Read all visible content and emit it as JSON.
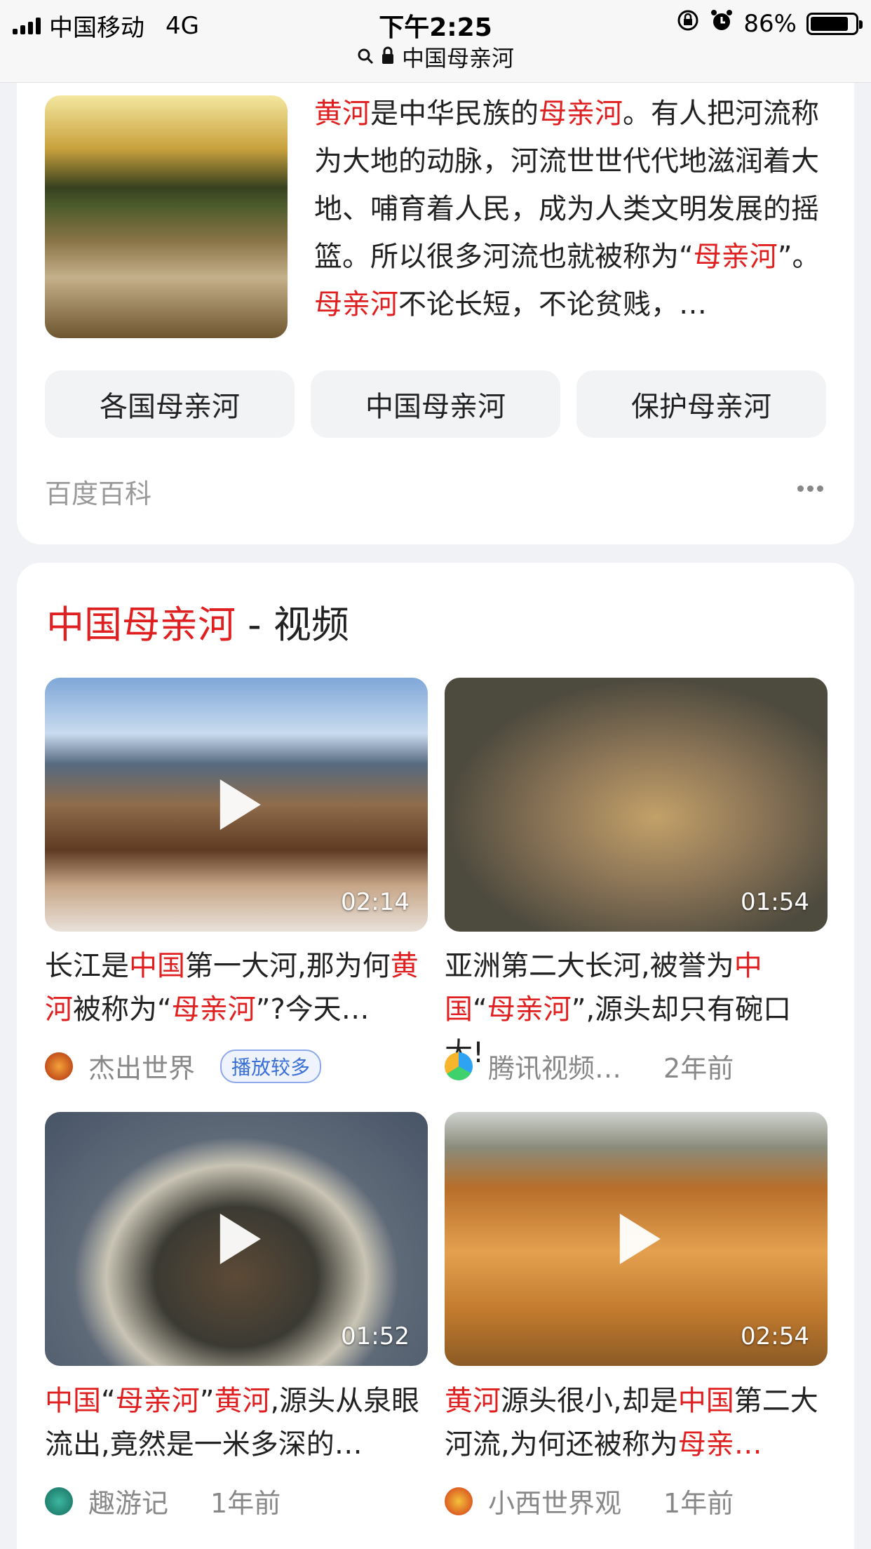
{
  "status_bar": {
    "carrier": "中国移动",
    "network": "4G",
    "time": "下午2:25",
    "battery": "86%",
    "battery_level": 0.86
  },
  "address_bar": {
    "title": "中国母亲河"
  },
  "baike": {
    "summary_parts": [
      {
        "text": "黄河",
        "hl": true
      },
      {
        "text": "是中华民族的",
        "hl": false
      },
      {
        "text": "母亲河",
        "hl": true
      },
      {
        "text": "。有人把河流称为大地的动脉，河流世世代代地滋润着大地、哺育着人民，成为人类文明发展的摇篮。所以很多河流也就被称为“",
        "hl": false
      },
      {
        "text": "母亲河",
        "hl": true
      },
      {
        "text": "”。",
        "hl": false
      },
      {
        "text": "母亲河",
        "hl": true
      },
      {
        "text": "不论长短，不论贫贱，…",
        "hl": false
      }
    ],
    "related": [
      "各国母亲河",
      "中国母亲河",
      "保护母亲河"
    ],
    "source": "百度百科"
  },
  "videos_section": {
    "title_keyword": "中国母亲河",
    "title_suffix": " - 视频",
    "items": [
      {
        "duration": "02:14",
        "title_parts": [
          {
            "text": "长江是",
            "hl": false
          },
          {
            "text": "中国",
            "hl": true
          },
          {
            "text": "第一大河,那为何",
            "hl": false
          },
          {
            "text": "黄河",
            "hl": true
          },
          {
            "text": "被称为“",
            "hl": false
          },
          {
            "text": "母亲河",
            "hl": true
          },
          {
            "text": "”?今天…",
            "hl": false
          }
        ],
        "author": "杰出世界",
        "badge": "播放较多",
        "time": ""
      },
      {
        "duration": "01:54",
        "title_parts": [
          {
            "text": "亚洲第二大长河,被誉为",
            "hl": false
          },
          {
            "text": "中国",
            "hl": true
          },
          {
            "text": "“",
            "hl": false
          },
          {
            "text": "母亲河",
            "hl": true
          },
          {
            "text": "”,源头却只有碗口大!",
            "hl": false
          }
        ],
        "author": "腾讯视频…",
        "badge": "",
        "time": "2年前"
      },
      {
        "duration": "01:52",
        "title_parts": [
          {
            "text": "中国",
            "hl": true
          },
          {
            "text": "“",
            "hl": false
          },
          {
            "text": "母亲河",
            "hl": true
          },
          {
            "text": "”",
            "hl": false
          },
          {
            "text": "黄河",
            "hl": true
          },
          {
            "text": ",源头从泉眼流出,竟然是一米多深的…",
            "hl": false
          }
        ],
        "author": "趣游记",
        "badge": "",
        "time": "1年前"
      },
      {
        "duration": "02:54",
        "title_parts": [
          {
            "text": "黄河",
            "hl": true
          },
          {
            "text": "源头很小,却是",
            "hl": false
          },
          {
            "text": "中国",
            "hl": true
          },
          {
            "text": "第二大河流,为何还被称为",
            "hl": false
          },
          {
            "text": "母亲…",
            "hl": true
          }
        ],
        "author": "小西世界观",
        "badge": "",
        "time": "1年前"
      }
    ]
  },
  "colors": {
    "highlight": "#e02020",
    "muted": "#999999",
    "badge": "#3a6fd8"
  }
}
